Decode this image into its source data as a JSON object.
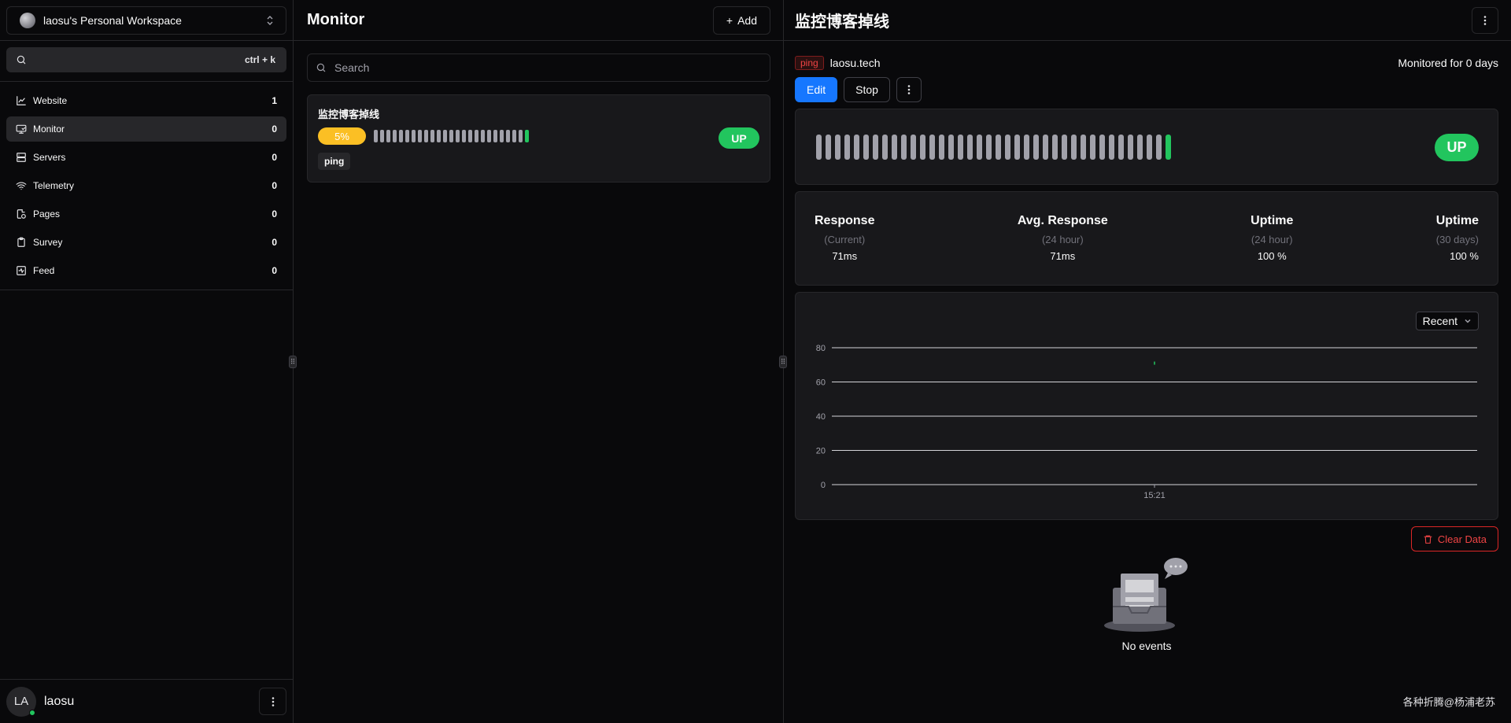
{
  "sidebar": {
    "workspace_name": "laosu's Personal Workspace",
    "search_shortcut": "ctrl + k",
    "nav": [
      {
        "label": "Website",
        "count": "1",
        "icon": "chart-icon"
      },
      {
        "label": "Monitor",
        "count": "0",
        "icon": "monitor-icon"
      },
      {
        "label": "Servers",
        "count": "0",
        "icon": "server-icon"
      },
      {
        "label": "Telemetry",
        "count": "0",
        "icon": "wifi-icon"
      },
      {
        "label": "Pages",
        "count": "0",
        "icon": "pages-icon"
      },
      {
        "label": "Survey",
        "count": "0",
        "icon": "clipboard-icon"
      },
      {
        "label": "Feed",
        "count": "0",
        "icon": "pulse-icon"
      }
    ],
    "user": {
      "initials": "LA",
      "name": "laosu"
    }
  },
  "list": {
    "title": "Monitor",
    "add_label": "Add",
    "search_placeholder": "Search",
    "monitor": {
      "name": "监控博客掉线",
      "uptime_pct": "5%",
      "status": "UP",
      "tag": "ping",
      "bars_total": 25,
      "bars_up": 1
    }
  },
  "detail": {
    "title": "监控博客掉线",
    "type_tag": "ping",
    "host": "laosu.tech",
    "monitored_for": "Monitored for 0 days",
    "edit_label": "Edit",
    "stop_label": "Stop",
    "status": "UP",
    "bars_total": 38,
    "bars_up": 1,
    "stats": [
      {
        "title": "Response",
        "sub": "(Current)",
        "value": "71ms"
      },
      {
        "title": "Avg. Response",
        "sub": "(24 hour)",
        "value": "71ms"
      },
      {
        "title": "Uptime",
        "sub": "(24 hour)",
        "value": "100 %"
      },
      {
        "title": "Uptime",
        "sub": "(30 days)",
        "value": "100 %"
      }
    ],
    "range_select": "Recent",
    "clear_label": "Clear Data",
    "empty_text": "No events",
    "footer_note": "各种折腾@杨浦老苏"
  },
  "colors": {
    "accent": "#1677ff",
    "up": "#22c55e",
    "warn": "#fbbf24",
    "danger": "#ef4444"
  },
  "chart_data": {
    "type": "line",
    "x": [
      "15:21"
    ],
    "series": [
      {
        "values": [
          71
        ]
      }
    ],
    "yticks": [
      0,
      20,
      40,
      60,
      80
    ],
    "ylim": [
      0,
      80
    ],
    "xlabel": "",
    "ylabel": "",
    "grid": true
  }
}
